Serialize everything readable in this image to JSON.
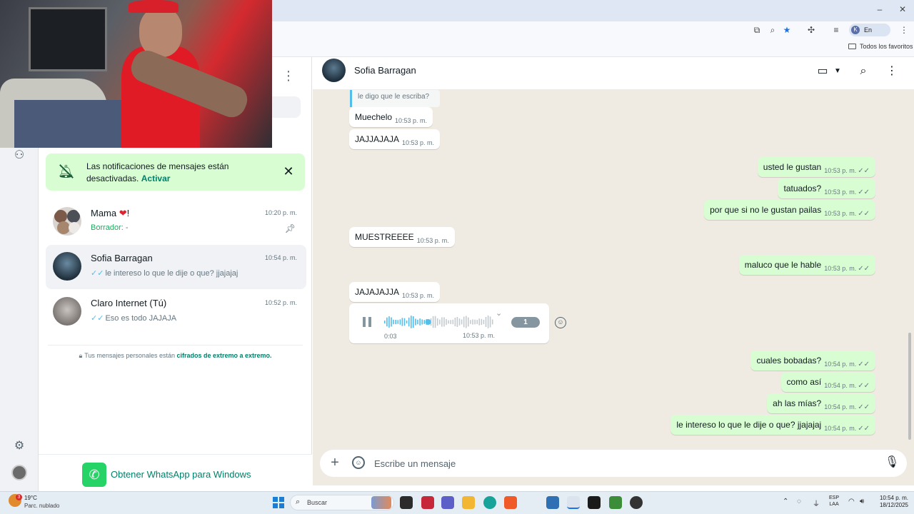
{
  "browser": {
    "profile_initial": "K",
    "profile_status": "En pausa",
    "bookmarks_all": "Todos los favoritos",
    "minimize": "–",
    "maximize": "⧉",
    "close": "✕"
  },
  "list": {
    "notification": {
      "text": "Las notificaciones de mensajes están desactivadas.",
      "action": "Activar"
    },
    "chats": [
      {
        "name": "Mama",
        "name_suffix": "!",
        "time": "10:20 p. m.",
        "preview_label": "Borrador:",
        "preview": "-",
        "pinned": true
      },
      {
        "name": "Sofia Barragan",
        "time": "10:54 p. m.",
        "ticks": "✓✓",
        "preview": "le intereso lo que le dije o que? jjajajaj",
        "active": true
      },
      {
        "name": "Claro Internet",
        "name_suffix": " (Tú)",
        "time": "10:52 p. m.",
        "ticks": "✓✓",
        "preview": "Eso es todo JAJAJA"
      }
    ],
    "e2e_prefix": "Tus mensajes personales están",
    "e2e_link": "cifrados de extremo a extremo.",
    "get_app": "Obtener WhatsApp para Windows"
  },
  "conversation": {
    "contact_name": "Sofia Barragan",
    "quoted_text": "le digo que le escriba?",
    "messages": [
      {
        "dir": "in",
        "text": "Muechelo",
        "time": "10:53 p. m."
      },
      {
        "dir": "in",
        "text": "JAJJAJAJA",
        "time": "10:53 p. m."
      },
      {
        "dir": "out",
        "text": "usted le gustan",
        "time": "10:53 p. m.",
        "ticks": "✓✓"
      },
      {
        "dir": "out",
        "text": "tatuados?",
        "time": "10:53 p. m.",
        "ticks": "✓✓"
      },
      {
        "dir": "out",
        "text": "por que si no le gustan pailas",
        "time": "10:53 p. m.",
        "ticks": "✓✓"
      },
      {
        "dir": "in",
        "text": "MUESTREEEE",
        "time": "10:53 p. m."
      },
      {
        "dir": "out",
        "text": "maluco que le hable",
        "time": "10:53 p. m.",
        "ticks": "✓✓"
      },
      {
        "dir": "in",
        "text": "JAJAJAJJA",
        "time": "10:53 p. m."
      },
      {
        "dir": "out",
        "text": "cuales bobadas?",
        "time": "10:54 p. m.",
        "ticks": "✓✓"
      },
      {
        "dir": "out",
        "text": "como así",
        "time": "10:54 p. m.",
        "ticks": "✓✓"
      },
      {
        "dir": "out",
        "text": "ah las mías?",
        "time": "10:54 p. m.",
        "ticks": "✓✓"
      },
      {
        "dir": "out",
        "text": "le intereso lo que le dije o que? jjajajaj",
        "time": "10:54 p. m.",
        "ticks": "✓✓"
      }
    ],
    "voice_note": {
      "duration": "0:03",
      "time": "10:53 p. m.",
      "speed": "1",
      "progress": 0.4,
      "played_color": "#53bdeb",
      "unplayed_color": "#c4cbcf"
    },
    "composer_placeholder": "Escribe un mensaje"
  },
  "taskbar": {
    "weather_temp": "19°C",
    "weather_desc": "Parc. nublado",
    "weather_badge": "3",
    "search_label": "Buscar",
    "lang_line1": "ESP",
    "lang_line2": "LAA",
    "clock_time": "10:54 p. m.",
    "clock_date": "18/12/2025"
  },
  "colors": {
    "accent": "#008069",
    "outgoing_bubble": "#d9fdd3",
    "chat_background": "#efeae2",
    "read_ticks": "#53bdeb"
  }
}
